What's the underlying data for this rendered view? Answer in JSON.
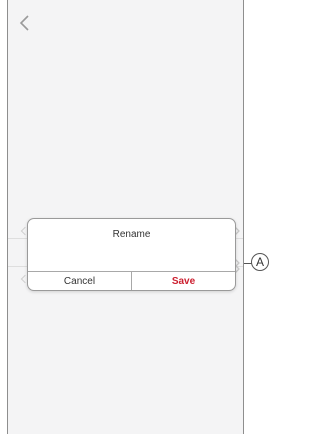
{
  "dialog": {
    "title": "Rename",
    "input_value": "",
    "cancel_label": "Cancel",
    "save_label": "Save"
  },
  "callout": {
    "label": "A"
  },
  "colors": {
    "screen_background": "#f4f4f5",
    "save_accent": "#cc1f2f",
    "callout_stroke": "#555555"
  },
  "icons": {
    "back": "chevron-left-icon",
    "row_chevron": "chevron-right-icon"
  }
}
